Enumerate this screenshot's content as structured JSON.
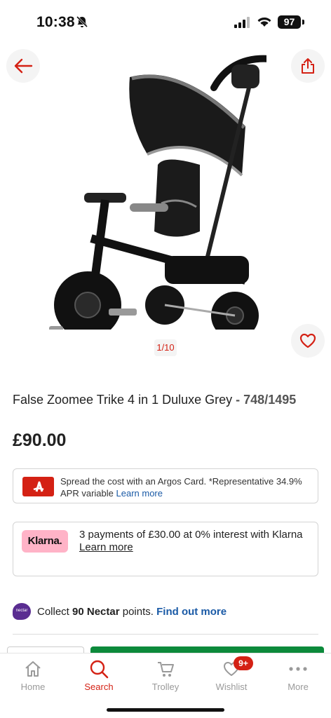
{
  "status_bar": {
    "time": "10:38",
    "battery": "97"
  },
  "gallery": {
    "pager": "1/10"
  },
  "product": {
    "title": "False Zoomee Trike 4 in 1 Duluxe Grey",
    "code": "748/1495",
    "price": "£90.00"
  },
  "argos_card": {
    "text": "Spread the cost with an Argos Card. *Representative 34.9% APR variable",
    "link": "Learn more"
  },
  "klarna": {
    "logo": "Klarna.",
    "text": "3 payments of £30.00 at 0% interest with Klarna",
    "link": "Learn more"
  },
  "nectar": {
    "logo": "nectar",
    "prefix": "Collect",
    "points": "90 Nectar",
    "suffix": "points.",
    "link": "Find out more"
  },
  "tabs": [
    {
      "label": "Home",
      "icon": "home-icon"
    },
    {
      "label": "Search",
      "icon": "search-icon",
      "active": true
    },
    {
      "label": "Trolley",
      "icon": "trolley-icon"
    },
    {
      "label": "Wishlist",
      "icon": "heart-icon",
      "badge": "9+"
    },
    {
      "label": "More",
      "icon": "more-icon"
    }
  ],
  "colors": {
    "brand_red": "#d42114",
    "link_blue": "#1a5aa6",
    "klarna_pink": "#ffb3c7",
    "nectar_purple": "#5a2d91",
    "cta_green": "#0c8a3b"
  }
}
